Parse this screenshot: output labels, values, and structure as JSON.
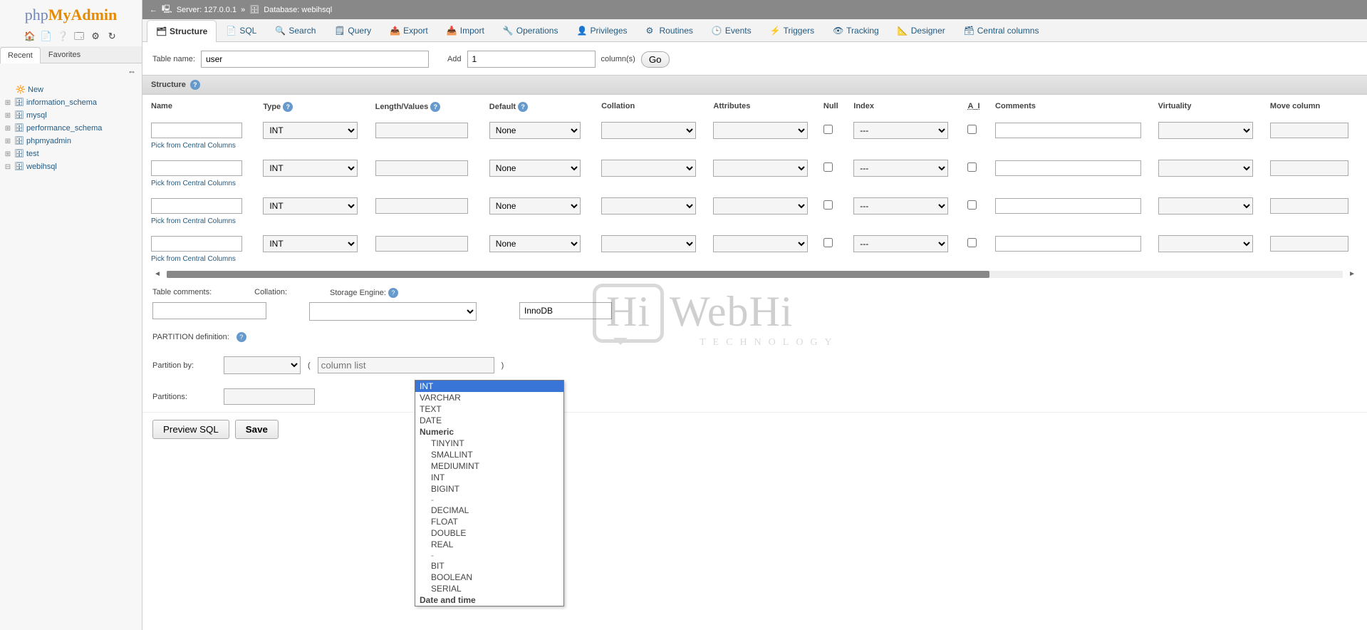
{
  "breadcrumb": {
    "server_label": "Server:",
    "server": "127.0.0.1",
    "db_label": "Database:",
    "db": "webihsql"
  },
  "sidebar": {
    "tabs": {
      "recent": "Recent",
      "favorites": "Favorites"
    },
    "new": "New",
    "dbs": [
      "information_schema",
      "mysql",
      "performance_schema",
      "phpmyadmin",
      "test",
      "webihsql"
    ]
  },
  "topmenu": {
    "structure": "Structure",
    "sql": "SQL",
    "search": "Search",
    "query": "Query",
    "export": "Export",
    "import": "Import",
    "operations": "Operations",
    "privileges": "Privileges",
    "routines": "Routines",
    "events": "Events",
    "triggers": "Triggers",
    "tracking": "Tracking",
    "designer": "Designer",
    "central": "Central columns"
  },
  "form": {
    "tablename_label": "Table name:",
    "tablename_value": "user",
    "add_label": "Add",
    "add_value": "1",
    "columns_label": "column(s)",
    "go": "Go"
  },
  "section": {
    "structure": "Structure"
  },
  "headers": {
    "name": "Name",
    "type": "Type",
    "len": "Length/Values",
    "def": "Default",
    "coll": "Collation",
    "attr": "Attributes",
    "null": "Null",
    "idx": "Index",
    "ai": "A_I",
    "com": "Comments",
    "virt": "Virtuality",
    "move": "Move column"
  },
  "row_defaults": {
    "type": "INT",
    "def": "None",
    "idx": "---",
    "pick": "Pick from Central Columns"
  },
  "dropdown": {
    "options": [
      "INT",
      "VARCHAR",
      "TEXT",
      "DATE"
    ],
    "group_numeric": "Numeric",
    "numeric": [
      "TINYINT",
      "SMALLINT",
      "MEDIUMINT",
      "INT",
      "BIGINT",
      "-",
      "DECIMAL",
      "FLOAT",
      "DOUBLE",
      "REAL",
      "-",
      "BIT",
      "BOOLEAN",
      "SERIAL"
    ],
    "group_datetime": "Date and time"
  },
  "meta": {
    "comments_label": "Table comments:",
    "collation_label": "Collation:",
    "engine_label": "Storage Engine:",
    "engine_value": "InnoDB"
  },
  "partition": {
    "def_label": "PARTITION definition:",
    "by_label": "Partition by:",
    "collist_ph": "column list",
    "count_label": "Partitions:"
  },
  "footer": {
    "preview": "Preview SQL",
    "save": "Save"
  },
  "watermark": {
    "brand": "Hi",
    "name": "WebHi",
    "sub": "TECHNOLOGY"
  }
}
